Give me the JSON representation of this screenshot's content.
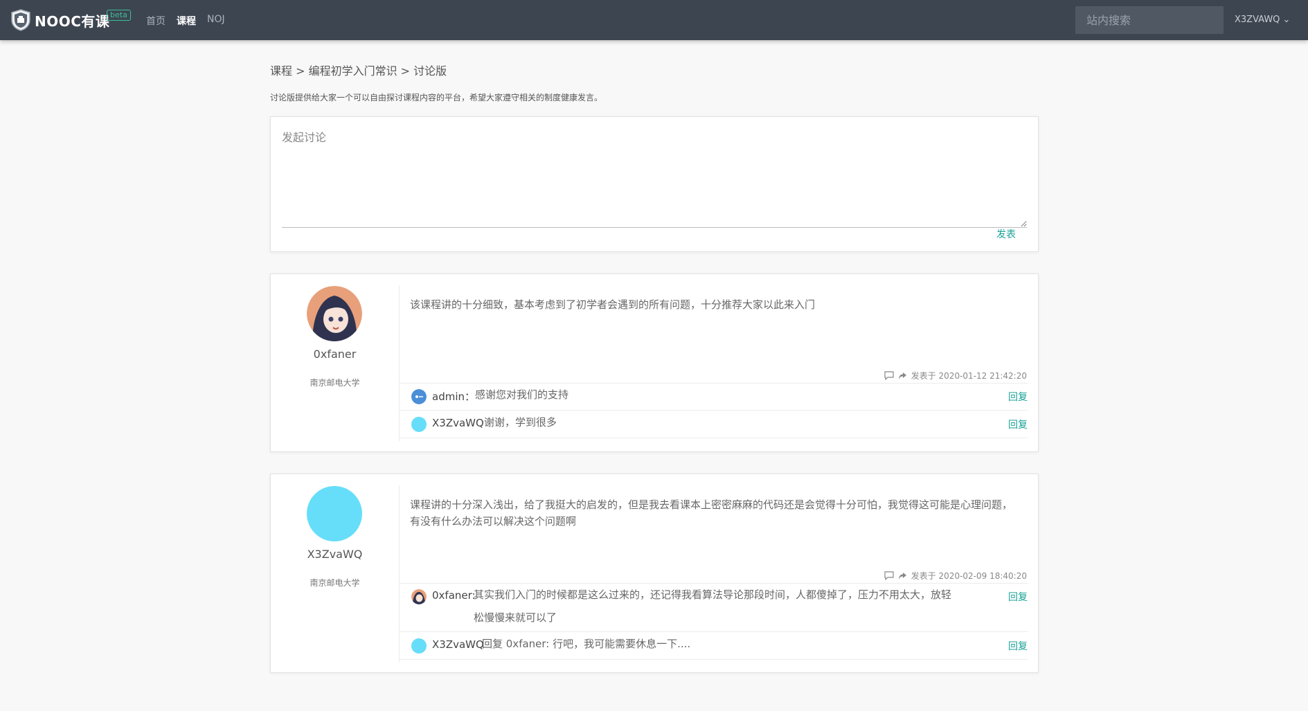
{
  "nav": {
    "brand": "NOOC有课",
    "beta": "beta",
    "links": [
      "首页",
      "课程",
      "NOJ"
    ],
    "search_placeholder": "站内搜索",
    "user": "X3ZVAWQ ⌄"
  },
  "breadcrumb": "课程 > 编程初学入门常识 > 讨论版",
  "intro": "讨论版提供给大家一个可以自由探讨课程内容的平台，希望大家遵守相关的制度健康发言。",
  "compose": {
    "placeholder": "发起讨论",
    "submit": "发表"
  },
  "posts": [
    {
      "author": "0xfaner",
      "school": "南京邮电大学",
      "content": "该课程讲的十分细致，基本考虑到了初学者会遇到的所有问题，十分推荐大家以此来入门",
      "meta": "发表于 2020-01-12 21:42:20",
      "replies": [
        {
          "name": "admin：",
          "text": "感谢您对我们的支持",
          "action": "回复"
        },
        {
          "name": "X3ZvaWQ",
          "text": ":谢谢，学到很多",
          "action": "回复"
        }
      ]
    },
    {
      "author": "X3ZvaWQ",
      "school": "南京邮电大学",
      "content": "课程讲的十分深入浅出，给了我挺大的启发的，但是我去看课本上密密麻麻的代码还是会觉得十分可怕，我觉得这可能是心理问题，有没有什么办法可以解决这个问题啊",
      "meta": "发表于 2020-02-09 18:40:20",
      "replies": [
        {
          "name": "0xfaner:",
          "text_line1": "其实我们入门的时候都是这么过来的，还记得我看算法导论那段时间，人都傻掉了，压力不用太大，放轻",
          "text_line2": "松慢慢来就可以了",
          "action": "回复"
        },
        {
          "name": "X3ZvaWQ",
          "text": "回复 0xfaner: 行吧，我可能需要休息一下....",
          "action": "回复"
        }
      ]
    }
  ],
  "colors": {
    "nav_bg": "#3d4550",
    "accent": "#1aa197",
    "avatar_blue": "#66def9"
  }
}
